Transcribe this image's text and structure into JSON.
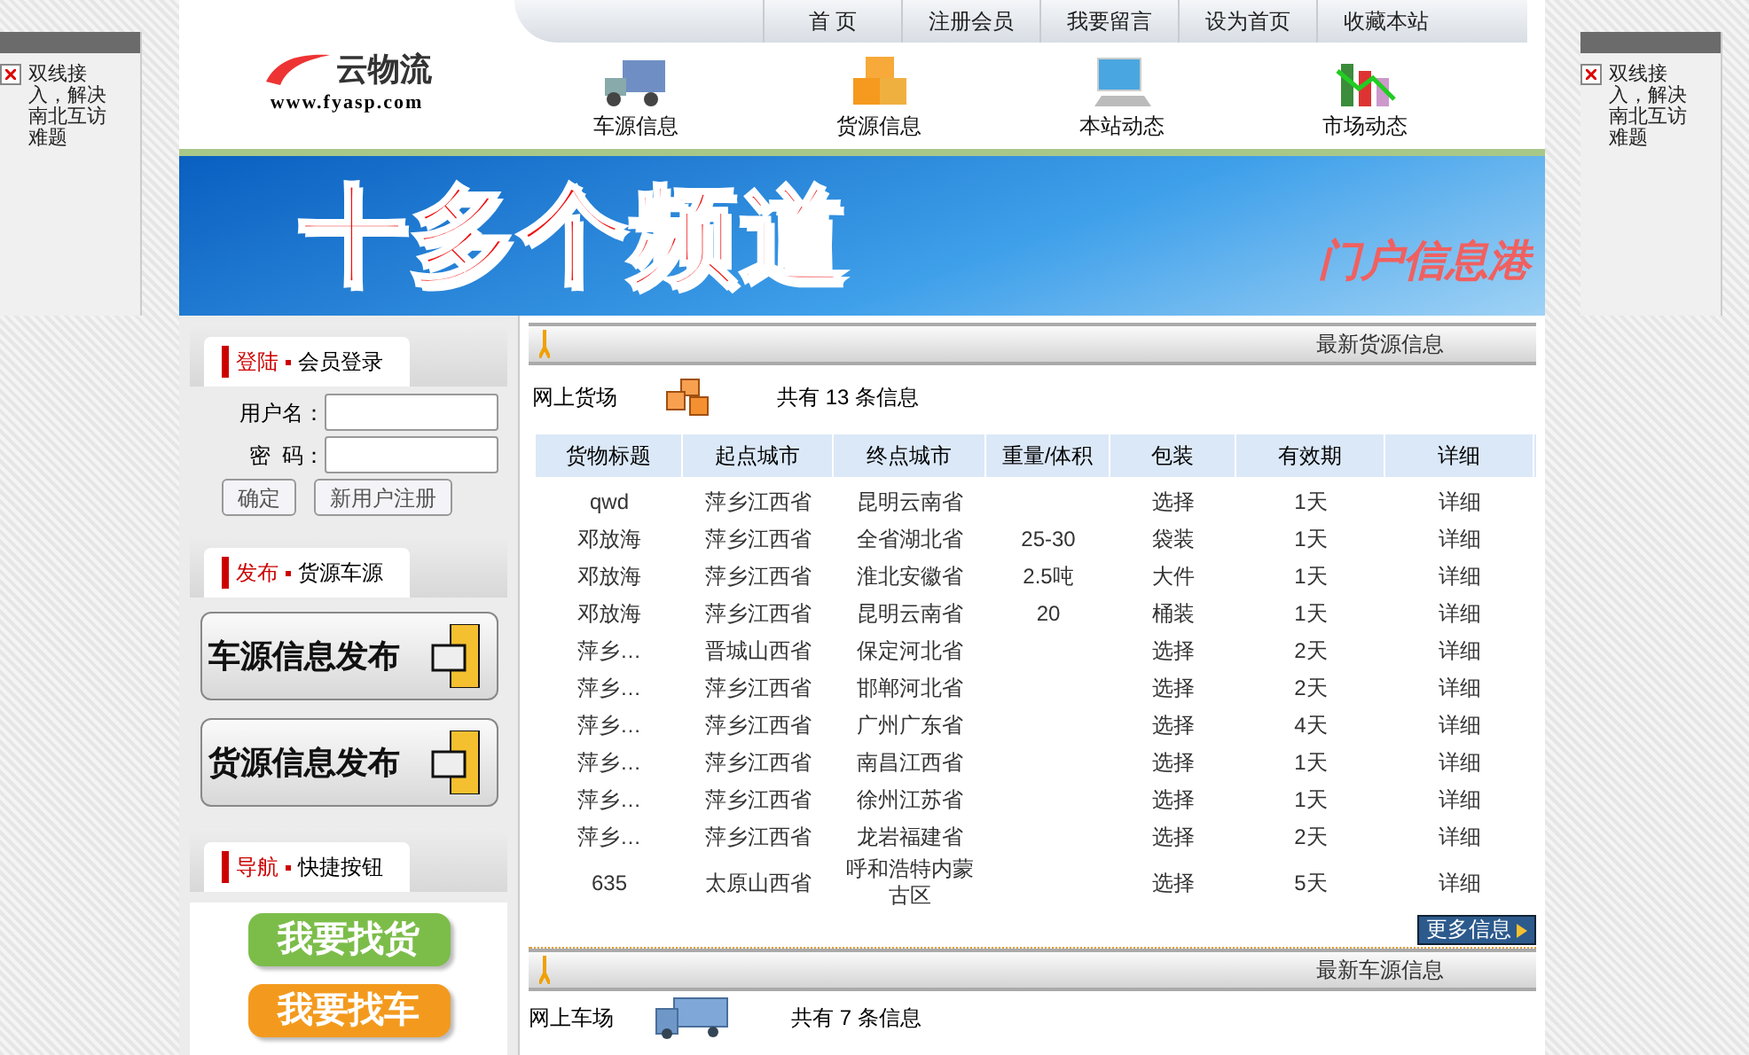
{
  "float_ads": [
    {
      "text": "双线接入，解决南北互访难题"
    },
    {
      "text": "双线接入，解决南北互访难题"
    }
  ],
  "header": {
    "logo": {
      "name": "云物流",
      "url": "www.fyasp.com"
    },
    "top_nav": [
      "首 页",
      "注册会员",
      "我要留言",
      "设为首页",
      "收藏本站"
    ],
    "channels": [
      {
        "label": "车源信息",
        "kind": "truck"
      },
      {
        "label": "货源信息",
        "kind": "boxes"
      },
      {
        "label": "本站动态",
        "kind": "monitor"
      },
      {
        "label": "市场动态",
        "kind": "chart"
      }
    ]
  },
  "banner": {
    "headline": "十多个频道",
    "tagline": "门户信息港"
  },
  "sidebar": {
    "login": {
      "prefix": "登陆",
      "title": "会员登录",
      "fields": [
        {
          "label": "用户名："
        },
        {
          "label": "密  码："
        }
      ],
      "buttons": [
        "确定",
        "新用户注册"
      ]
    },
    "publish": {
      "prefix": "发布",
      "title": "货源车源",
      "buttons": [
        "车源信息发布",
        "货源信息发布"
      ]
    },
    "shortcuts": {
      "prefix": "导航",
      "title": "快捷按钮",
      "buttons": [
        {
          "label": "我要找货",
          "color": "#7cbd4a"
        },
        {
          "label": "我要找车",
          "color": "#f39a1e"
        }
      ]
    }
  },
  "cargo": {
    "header": "最新货源信息",
    "label": "网上货场",
    "count": "共有 13 条信息",
    "columns": [
      "货物标题",
      "起点城市",
      "终点城市",
      "重量/体积",
      "包装",
      "有效期",
      "详细"
    ],
    "rows": [
      {
        "title": "qwd",
        "origin": "萍乡江西省",
        "destination": "昆明云南省",
        "packing": "选择",
        "validity": "1天",
        "detail": "详细"
      },
      {
        "title": "邓放海",
        "origin": "萍乡江西省",
        "destination": "全省湖北省",
        "weight": "25-30",
        "packing": "袋装",
        "validity": "1天",
        "detail": "详细"
      },
      {
        "title": "邓放海",
        "origin": "萍乡江西省",
        "destination": "淮北安徽省",
        "weight": "2.5吨",
        "packing": "大件",
        "validity": "1天",
        "detail": "详细"
      },
      {
        "title": "邓放海",
        "origin": "萍乡江西省",
        "destination": "昆明云南省",
        "weight": "20",
        "packing": "桶装",
        "validity": "1天",
        "detail": "详细"
      },
      {
        "title": "萍乡…",
        "origin": "晋城山西省",
        "destination": "保定河北省",
        "packing": "选择",
        "validity": "2天",
        "detail": "详细"
      },
      {
        "title": "萍乡…",
        "origin": "萍乡江西省",
        "destination": "邯郸河北省",
        "packing": "选择",
        "validity": "2天",
        "detail": "详细"
      },
      {
        "title": "萍乡…",
        "origin": "萍乡江西省",
        "destination": "广州广东省",
        "packing": "选择",
        "validity": "4天",
        "detail": "详细"
      },
      {
        "title": "萍乡…",
        "origin": "萍乡江西省",
        "destination": "南昌江西省",
        "packing": "选择",
        "validity": "1天",
        "detail": "详细"
      },
      {
        "title": "萍乡…",
        "origin": "萍乡江西省",
        "destination": "徐州江苏省",
        "packing": "选择",
        "validity": "1天",
        "detail": "详细"
      },
      {
        "title": "萍乡…",
        "origin": "萍乡江西省",
        "destination": "龙岩福建省",
        "packing": "选择",
        "validity": "2天",
        "detail": "详细"
      },
      {
        "title": "635",
        "origin": "太原山西省",
        "destination": "呼和浩特内蒙古区",
        "packing": "选择",
        "validity": "5天",
        "detail": "详细"
      }
    ],
    "more": "更多信息"
  },
  "vehicles": {
    "header": "最新车源信息",
    "label": "网上车场",
    "count": "共有 7 条信息"
  }
}
